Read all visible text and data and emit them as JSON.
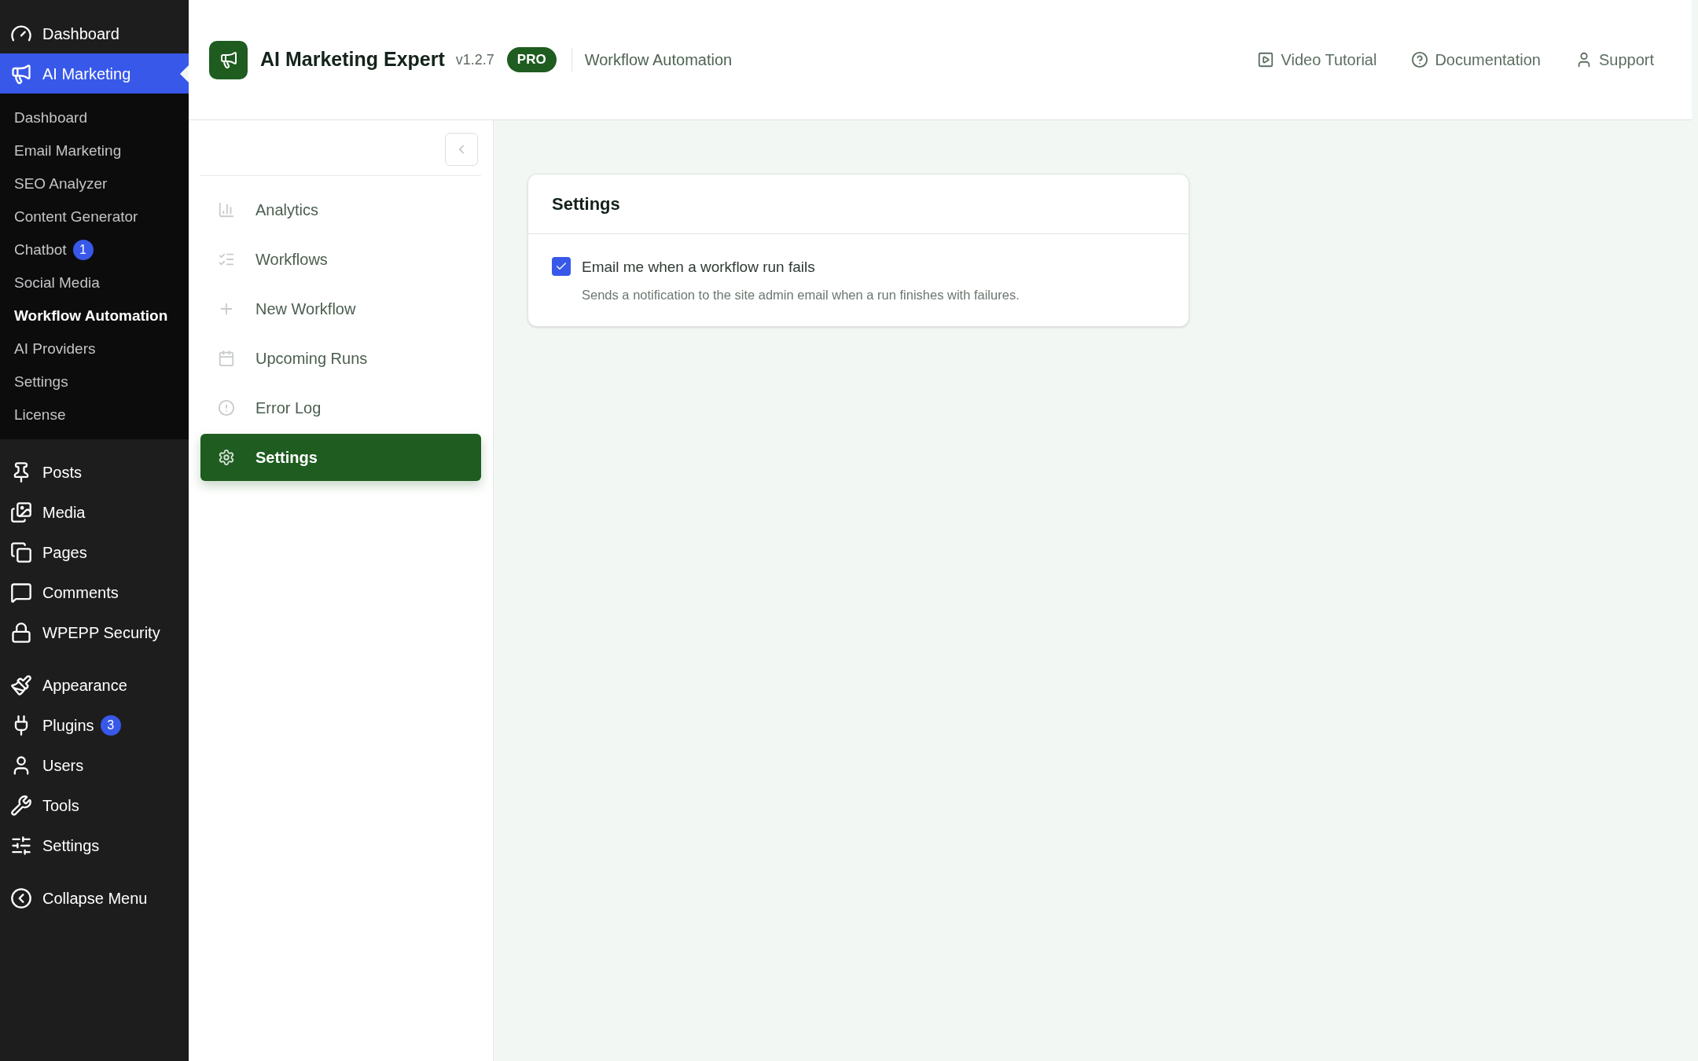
{
  "wp_menu": {
    "groups": [
      [
        {
          "label": "Dashboard",
          "selected": false
        },
        {
          "label": "AI Marketing",
          "selected": true,
          "submenu": [
            {
              "label": "Dashboard",
              "selected": false
            },
            {
              "label": "Email Marketing",
              "selected": false
            },
            {
              "label": "SEO Analyzer",
              "selected": false
            },
            {
              "label": "Content Generator",
              "selected": false
            },
            {
              "label": "Chatbot",
              "badge": "1",
              "selected": false
            },
            {
              "label": "Social Media",
              "selected": false
            },
            {
              "label": "Workflow Automation",
              "selected": true
            },
            {
              "label": "AI Providers",
              "selected": false
            },
            {
              "label": "Settings",
              "selected": false
            },
            {
              "label": "License",
              "selected": false
            }
          ]
        }
      ],
      [
        {
          "label": "Posts",
          "selected": false
        },
        {
          "label": "Media",
          "selected": false
        },
        {
          "label": "Pages",
          "selected": false
        },
        {
          "label": "Comments",
          "selected": false
        },
        {
          "label": "WPEPP Security",
          "selected": false
        }
      ],
      [
        {
          "label": "Appearance",
          "selected": false
        },
        {
          "label": "Plugins",
          "badge": "3",
          "selected": false
        },
        {
          "label": "Users",
          "selected": false
        },
        {
          "label": "Tools",
          "selected": false
        },
        {
          "label": "Settings",
          "selected": false
        }
      ],
      [
        {
          "label": "Collapse Menu",
          "selected": false
        }
      ]
    ]
  },
  "header": {
    "title": "AI Marketing Expert",
    "version": "v1.2.7",
    "badge": "PRO",
    "section": "Workflow Automation",
    "links": [
      {
        "label": "Video Tutorial"
      },
      {
        "label": "Documentation"
      },
      {
        "label": "Support"
      }
    ]
  },
  "plugin_nav": {
    "items": [
      {
        "label": "Analytics",
        "selected": false
      },
      {
        "label": "Workflows",
        "selected": false
      },
      {
        "label": "New Workflow",
        "selected": false
      },
      {
        "label": "Upcoming Runs",
        "selected": false
      },
      {
        "label": "Error Log",
        "selected": false
      },
      {
        "label": "Settings",
        "selected": true
      }
    ]
  },
  "settings_card": {
    "title": "Settings",
    "options": [
      {
        "label": "Email me when a workflow run fails",
        "description": "Sends a notification to the site admin email when a run finishes with failures.",
        "checked": true
      }
    ]
  }
}
